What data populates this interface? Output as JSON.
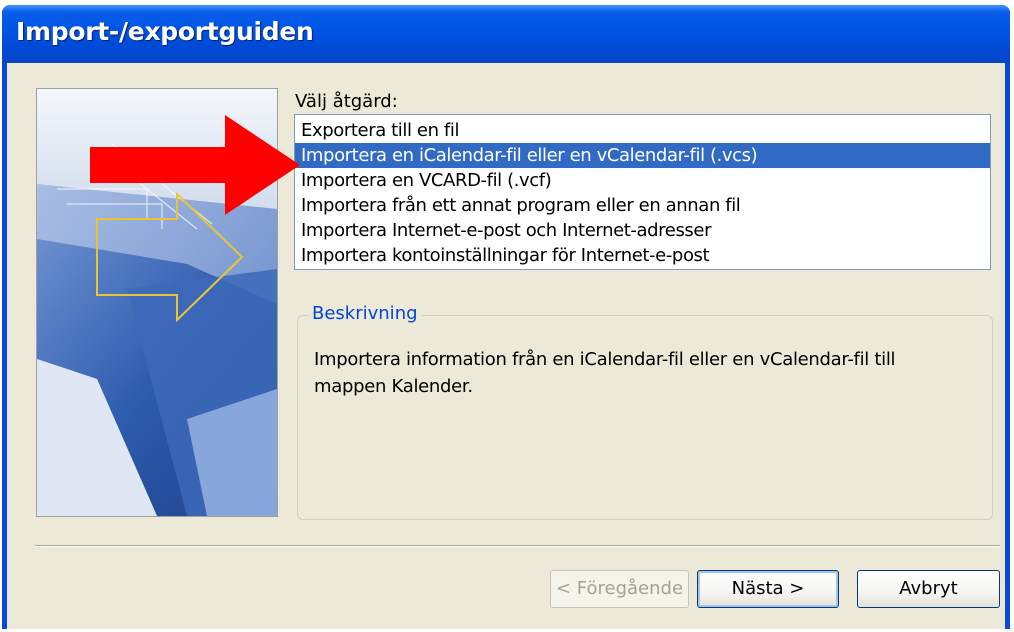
{
  "window": {
    "title": "Import-/exportguiden"
  },
  "main": {
    "action_label": "Välj åtgärd:",
    "actions": [
      {
        "label": "Exportera till en fil",
        "selected": false
      },
      {
        "label": "Importera en iCalendar-fil eller en vCalendar-fil (.vcs)",
        "selected": true
      },
      {
        "label": "Importera en VCARD-fil (.vcf)",
        "selected": false
      },
      {
        "label": "Importera från ett annat program eller en annan fil",
        "selected": false
      },
      {
        "label": "Importera Internet-e-post och Internet-adresser",
        "selected": false
      },
      {
        "label": "Importera kontoinställningar för Internet-e-post",
        "selected": false
      }
    ],
    "description": {
      "label": "Beskrivning",
      "text": "Importera information från en iCalendar-fil eller en vCalendar-fil till mappen Kalender."
    }
  },
  "buttons": {
    "back_label": "< Föregående",
    "next_label": "Nästa >",
    "cancel_label": "Avbryt"
  },
  "colors": {
    "titlebar": "#0055e5",
    "selection": "#316ac5",
    "annotation_arrow": "#ff0000",
    "group_label": "#0046d5"
  },
  "icons": {
    "wizard_image": "import-export-wizard-graphic",
    "annotation": "red-arrow-pointer"
  }
}
